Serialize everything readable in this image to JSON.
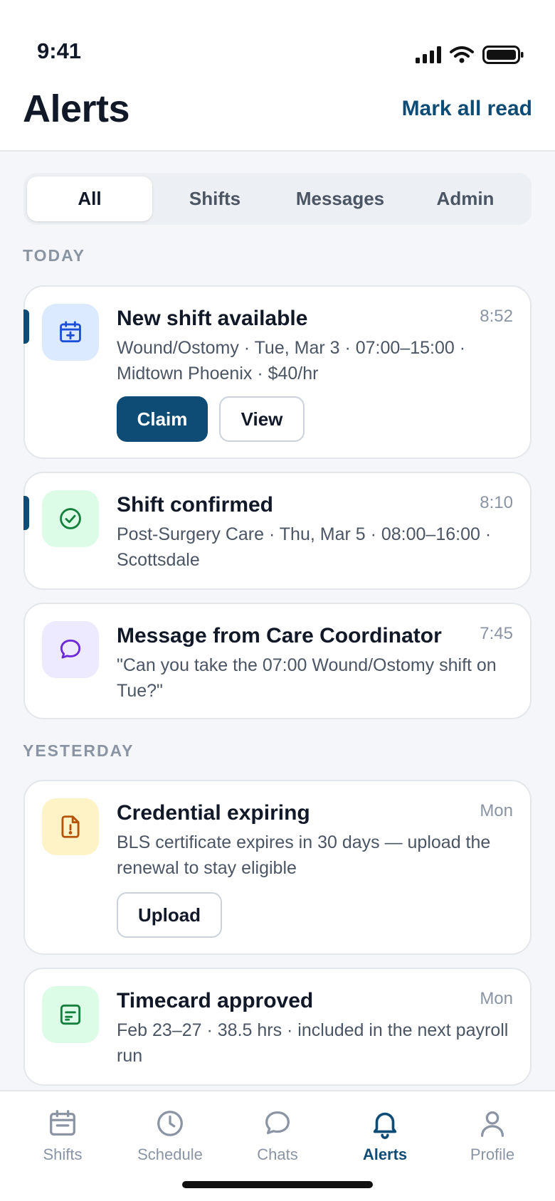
{
  "status_bar": {
    "time": "9:41"
  },
  "header": {
    "title": "Alerts",
    "mark_all_label": "Mark all read"
  },
  "filters": [
    "All",
    "Shifts",
    "Messages",
    "Admin"
  ],
  "sections": {
    "today": "TODAY",
    "yesterday": "YESTERDAY"
  },
  "alerts": [
    {
      "title": "New shift available",
      "time": "8:52",
      "body": "Wound/Ostomy · Tue, Mar 3 · 07:00–15:00 · Midtown Phoenix · $40/hr",
      "icon": "calendar-plus-icon",
      "unread": true,
      "actions": [
        "Claim",
        "View"
      ]
    },
    {
      "title": "Shift confirmed",
      "time": "8:10",
      "body": "Post-Surgery Care · Thu, Mar 5 · 08:00–16:00 · Scottsdale",
      "icon": "check-circle-icon",
      "unread": true
    },
    {
      "title": "Message from Care Coordinator",
      "time": "7:45",
      "body": "\"Can you take the 07:00 Wound/Ostomy shift on Tue?\"",
      "icon": "chat-bubble-icon",
      "unread": false
    },
    {
      "title": "Credential expiring",
      "time": "Mon",
      "body": "BLS certificate expires in 30 days — upload the renewal to stay eligible",
      "icon": "document-alert-icon",
      "unread": false,
      "actions": [
        "Upload"
      ]
    },
    {
      "title": "Timecard approved",
      "time": "Mon",
      "body": "Feb 23–27 · 38.5 hrs · included in the next payroll run",
      "icon": "timecard-icon",
      "unread": false
    }
  ],
  "tabbar": [
    "Shifts",
    "Schedule",
    "Chats",
    "Alerts",
    "Profile"
  ],
  "colors": {
    "accent": "#0f4c75",
    "calendar_bg": "#dbeafe",
    "check_bg": "#dcfce7",
    "message_bg": "#ede9fe",
    "warning_bg": "#fef3c7",
    "timecard_bg": "#dcfce7"
  }
}
